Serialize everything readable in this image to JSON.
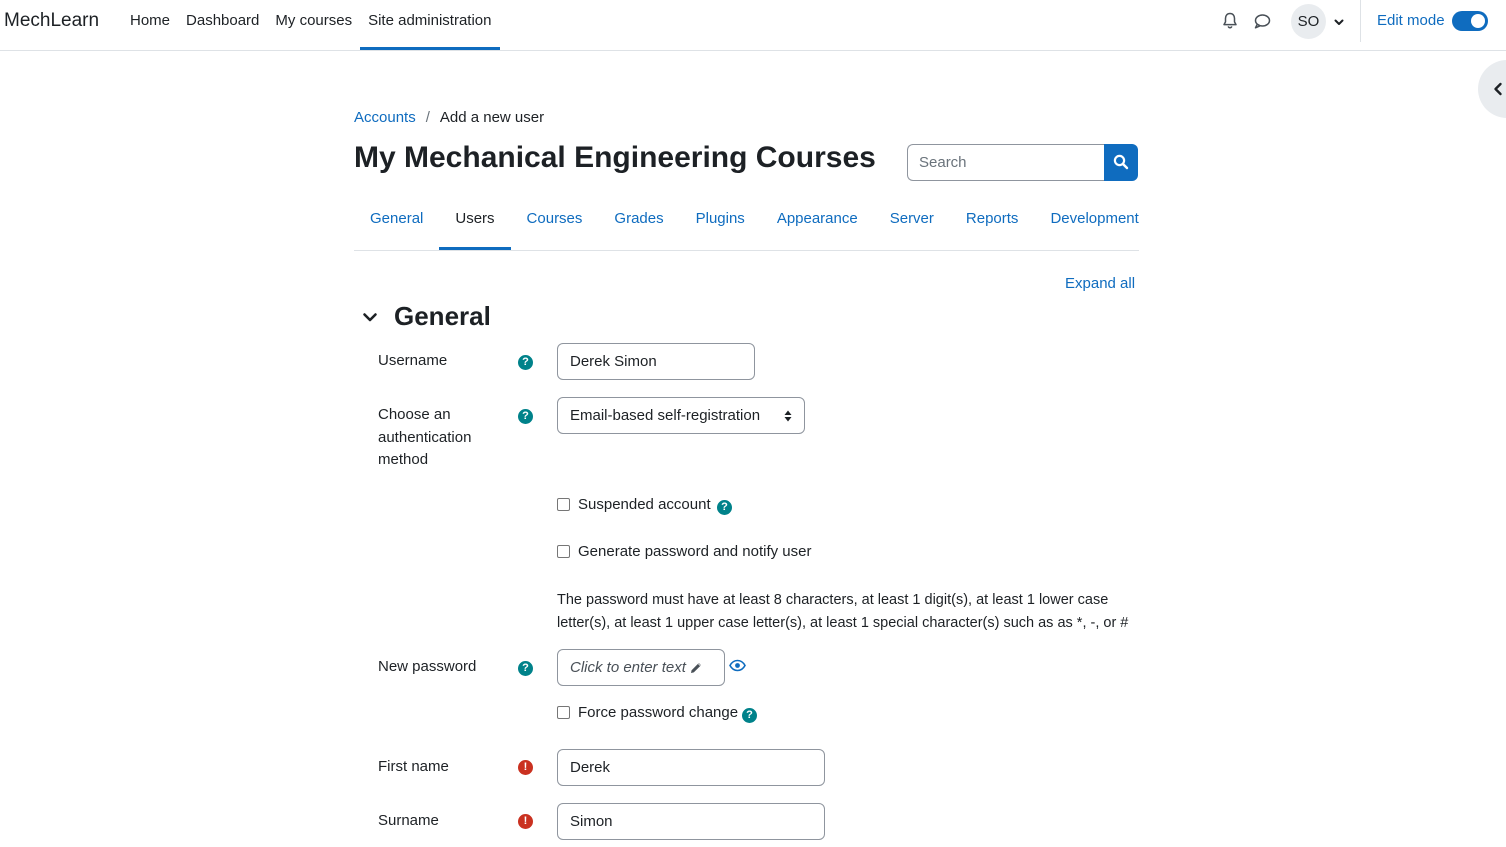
{
  "navbar": {
    "brand": "MechLearn",
    "links": [
      {
        "label": "Home",
        "active": false
      },
      {
        "label": "Dashboard",
        "active": false
      },
      {
        "label": "My courses",
        "active": false
      },
      {
        "label": "Site administration",
        "active": true
      }
    ],
    "user_initials": "SO",
    "edit_mode_label": "Edit mode",
    "edit_mode_on": true
  },
  "breadcrumb": {
    "parent": "Accounts",
    "separator": "/",
    "current": "Add a new user"
  },
  "page_title": "My Mechanical Engineering Courses",
  "search": {
    "placeholder": "Search"
  },
  "tabs": [
    {
      "label": "General",
      "active": false
    },
    {
      "label": "Users",
      "active": true
    },
    {
      "label": "Courses",
      "active": false
    },
    {
      "label": "Grades",
      "active": false
    },
    {
      "label": "Plugins",
      "active": false
    },
    {
      "label": "Appearance",
      "active": false
    },
    {
      "label": "Server",
      "active": false
    },
    {
      "label": "Reports",
      "active": false
    },
    {
      "label": "Development",
      "active": false
    }
  ],
  "expand_all": "Expand all",
  "section": {
    "title": "General"
  },
  "form": {
    "username": {
      "label": "Username",
      "value": "Derek Simon"
    },
    "auth_method": {
      "label": "Choose an authentication method",
      "value": "Email-based self-registration"
    },
    "suspended": {
      "label": "Suspended account",
      "checked": false
    },
    "generate_password": {
      "label": "Generate password and notify user",
      "checked": false
    },
    "password_policy": "The password must have at least 8 characters, at least 1 digit(s), at least 1 lower case letter(s), at least 1 upper case letter(s), at least 1 special character(s) such as as *, -, or #",
    "new_password": {
      "label": "New password",
      "placeholder": "Click to enter text"
    },
    "force_change": {
      "label": "Force password change",
      "checked": false
    },
    "first_name": {
      "label": "First name",
      "value": "Derek"
    },
    "surname": {
      "label": "Surname",
      "value": "Simon"
    }
  },
  "colors": {
    "accent": "#0f6cbf",
    "help_icon": "#00828a",
    "required_icon": "#ca3120",
    "text": "#1d2125"
  },
  "icons": {
    "notifications": "bell-icon",
    "messages": "chat-bubble-icon",
    "search": "search-icon",
    "help": "question-circle-icon",
    "required": "exclamation-circle-icon",
    "edit": "pencil-icon",
    "reveal_password": "eye-icon",
    "section_toggle": "chevron-down-icon",
    "drawer": "chevron-left-icon"
  }
}
